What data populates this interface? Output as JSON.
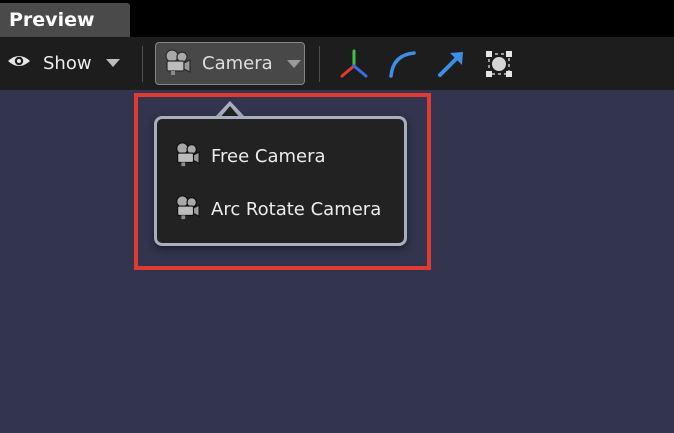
{
  "window": {
    "tab_label": "Preview"
  },
  "toolbar": {
    "show_label": "Show",
    "show_icon": "eye-icon",
    "camera_label": "Camera",
    "camera_icon": "camera-icon",
    "tools": [
      {
        "name": "axes-icon"
      },
      {
        "name": "arc-icon"
      },
      {
        "name": "arrow-icon"
      },
      {
        "name": "bounding-box-icon"
      }
    ]
  },
  "camera_menu": {
    "items": [
      {
        "label": "Free Camera",
        "icon": "camera-icon"
      },
      {
        "label": "Arc Rotate Camera",
        "icon": "camera-icon"
      }
    ]
  },
  "colors": {
    "viewport_bg": "#33344d",
    "toolbar_bg": "#1d1d1d",
    "highlight": "#e03b32",
    "popup_border": "#a7aebf",
    "accent_blue": "#3d8fe6"
  }
}
